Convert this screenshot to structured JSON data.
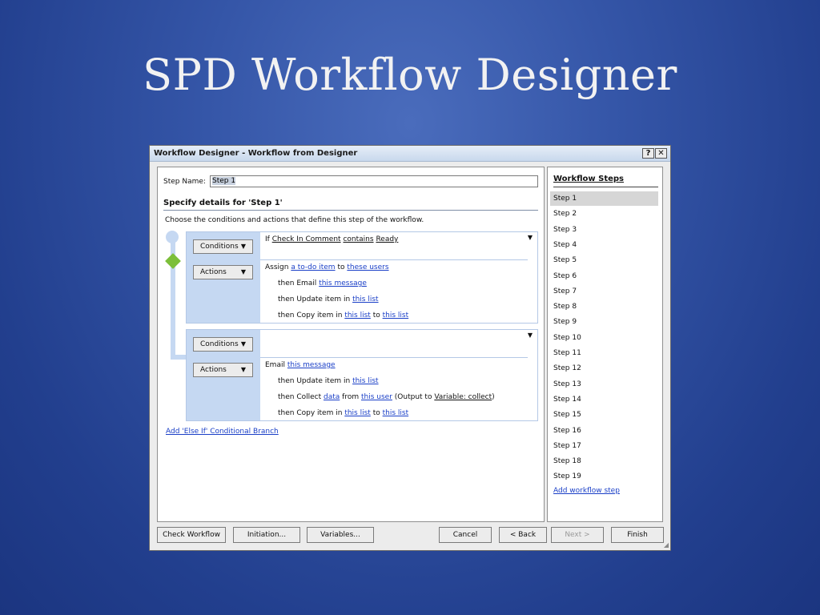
{
  "slide": {
    "title": "SPD Workflow Designer"
  },
  "window": {
    "title": "Workflow Designer - Workflow from Designer",
    "help_label": "?",
    "close_label": "✕"
  },
  "step_name": {
    "label": "Step Name:",
    "value": "Step 1"
  },
  "details": {
    "heading": "Specify details for 'Step 1'",
    "description": "Choose the conditions and actions that define this step of the workflow."
  },
  "block1": {
    "conditions_label": "Conditions",
    "actions_label": "Actions",
    "condition": {
      "prefix": "If",
      "field": "Check In Comment",
      "operator": "contains",
      "value": "Ready"
    },
    "actions": {
      "a1": {
        "prefix": "Assign",
        "link1": "a to-do item",
        "mid": "to",
        "link2": "these users"
      },
      "a2": {
        "prefix": "then Email",
        "link1": "this message"
      },
      "a3": {
        "prefix": "then Update item in",
        "link1": "this list"
      },
      "a4": {
        "prefix": "then Copy item in",
        "link1": "this list",
        "mid": "to",
        "link2": "this list"
      }
    }
  },
  "block2": {
    "conditions_label": "Conditions",
    "actions_label": "Actions",
    "actions": {
      "a1": {
        "prefix": "Email",
        "link1": "this message"
      },
      "a2": {
        "prefix": "then Update item in",
        "link1": "this list"
      },
      "a3": {
        "prefix": "then Collect",
        "link1": "data",
        "mid": "from",
        "link2": "this user",
        "mid2": "(Output to",
        "link3": "Variable: collect",
        "suffix": ")"
      },
      "a4": {
        "prefix": "then Copy item in",
        "link1": "this list",
        "mid": "to",
        "link2": "this list"
      }
    }
  },
  "add_else_if": "Add 'Else If' Conditional Branch",
  "steps_panel": {
    "title": "Workflow Steps",
    "steps": [
      "Step 1",
      "Step 2",
      "Step 3",
      "Step 4",
      "Step 5",
      "Step 6",
      "Step 7",
      "Step 8",
      "Step 9",
      "Step 10",
      "Step 11",
      "Step 12",
      "Step 13",
      "Step 14",
      "Step 15",
      "Step 16",
      "Step 17",
      "Step 18",
      "Step 19"
    ],
    "add_label": "Add workflow step"
  },
  "buttons": {
    "check_workflow": "Check Workflow",
    "initiation": "Initiation...",
    "variables": "Variables...",
    "cancel": "Cancel",
    "back": "< Back",
    "next": "Next >",
    "finish": "Finish"
  },
  "colors": {
    "background": "#2b4a9e",
    "branch_rail": "#c5d8f2",
    "diamond": "#7cbf3a",
    "link": "#1a3fc7"
  },
  "icons": {
    "dropdown": "triangle-down",
    "diamond": "green-diamond"
  }
}
